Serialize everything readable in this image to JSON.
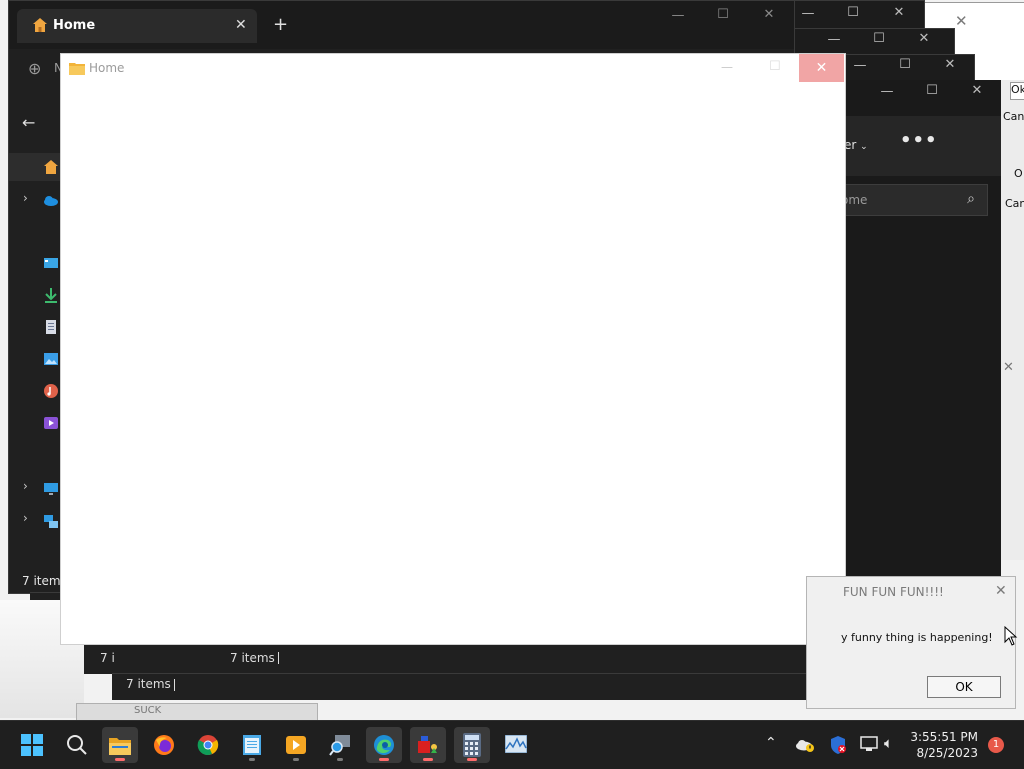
{
  "explorer": {
    "tab_title": "Home",
    "status": "7 items",
    "address_fragment": "N"
  },
  "ghost_window": {
    "title": "Home"
  },
  "trail_status": {
    "t1": "7 i",
    "t2": "7 i",
    "t3": "7 items",
    "t4": "7 items"
  },
  "right_window": {
    "menu_label": "er",
    "search_placeholder": "ome"
  },
  "far_right": {
    "ok_label": "Ok",
    "cancel_label": "Canc",
    "o_label": "O",
    "can_label": "Can"
  },
  "dialog": {
    "title": "FUN FUN FUN!!!!",
    "message": "y funny thing is happening!",
    "ok_button": "OK"
  },
  "bottom_fragment": "SUCK",
  "taskbar": {
    "time": "3:55:51 PM",
    "date": "8/25/2023",
    "notification_count": "1"
  },
  "colors": {
    "accent": "#0078d4",
    "folder": "#f2b43a",
    "close_red": "#f1a5a5",
    "badge_red": "#e81123"
  }
}
